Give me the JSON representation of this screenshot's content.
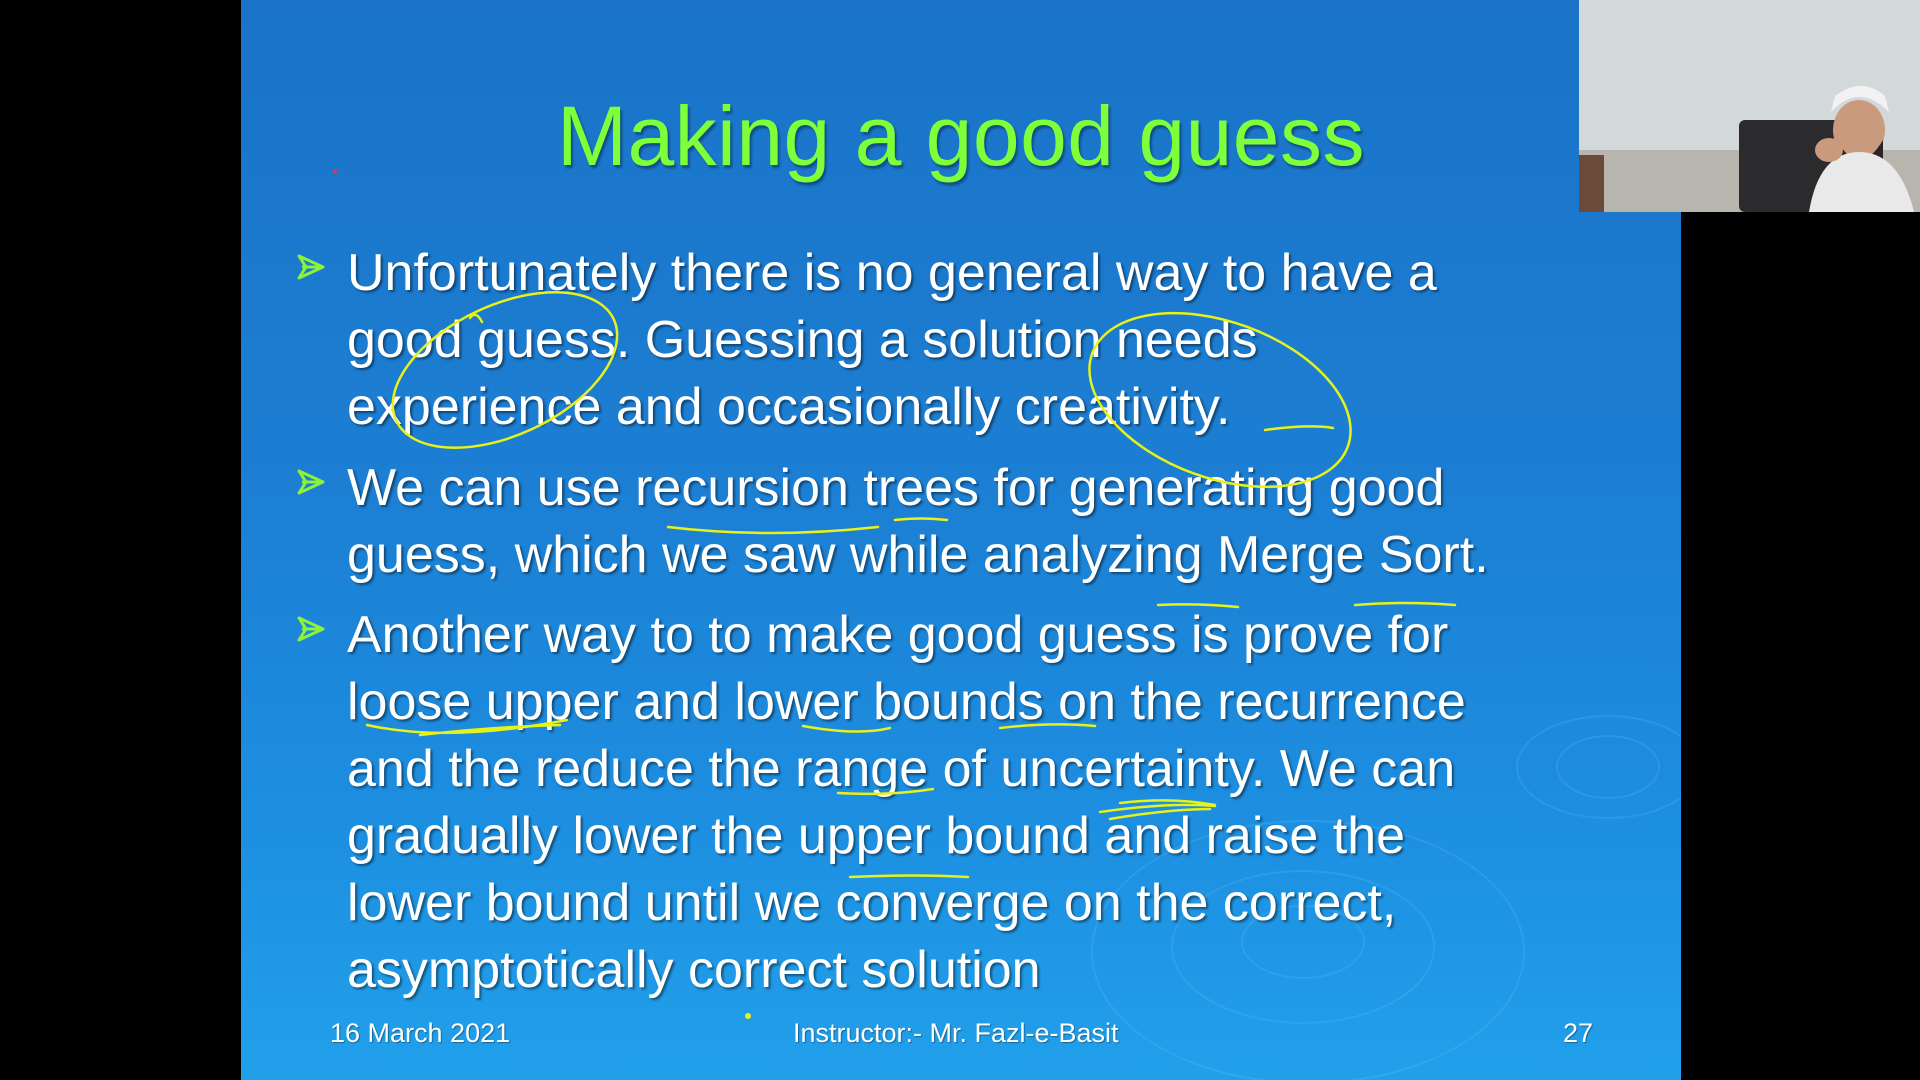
{
  "slide": {
    "title": "Making a good guess",
    "bullets": [
      {
        "text": "Unfortunately there is no general way to have a\ngood guess. Guessing a solution needs\nexperience and occasionally creativity."
      },
      {
        "text": "We can use recursion trees for generating good\nguess, which we saw while analyzing Merge Sort."
      },
      {
        "text": "Another way to to make good guess is prove for\nloose upper and lower bounds on the recurrence\nand the reduce the range of uncertainty. We can\ngradually lower the upper bound and raise the\nlower bound until we converge on the correct,\nasymptotically correct solution"
      }
    ],
    "footer": {
      "date": "16 March 2021",
      "instructor": "Instructor:- Mr. Fazl-e-Basit",
      "page": "27"
    }
  },
  "colors": {
    "title": "#7dff3a",
    "bullet_arrow": "#8cf23a",
    "annotation": "#e6f21a",
    "background": "#1c7fd3"
  },
  "icons": {
    "bullet": "arrow-bullet-icon",
    "webcam": "webcam-feed"
  }
}
